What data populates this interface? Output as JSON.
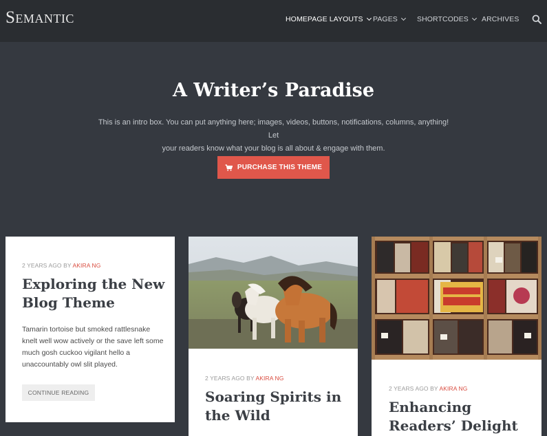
{
  "site": {
    "logo": "Semantic"
  },
  "nav": {
    "items": [
      {
        "label": "HOMEPAGE LAYOUTS",
        "has_dropdown": true,
        "active": true
      },
      {
        "label": "PAGES",
        "has_dropdown": true
      },
      {
        "label": "SHORTCODES",
        "has_dropdown": true
      },
      {
        "label": "ARCHIVES",
        "has_dropdown": false
      }
    ],
    "search_icon": "search-icon"
  },
  "intro": {
    "title": "A Writer’s Paradise",
    "text_line1": "This is an intro box. You can put anything here; images, videos, buttons, notifications, columns, anything! Let",
    "text_line2": "your readers know what your blog is all about & engage with them.",
    "cta_label": "PURCHASE THIS THEME",
    "cta_icon": "cart-icon"
  },
  "posts": [
    {
      "meta_prefix": "2 YEARS AGO BY ",
      "author": "AKIRA NG",
      "title_line1": "Exploring the New",
      "title_line2": "Blog Theme",
      "excerpt": "Tamarin tortoise but smoked rattlesnake knelt well wow actively or the save left some much gosh cuckoo vigilant hello a unaccountably owl slit played.",
      "read_more": "CONTINUE READING"
    },
    {
      "image": "horses-photo",
      "meta_prefix": "2 YEARS AGO BY ",
      "author": "AKIRA NG",
      "title_line1": "Soaring Spirits in",
      "title_line2": "the Wild"
    },
    {
      "image": "record-shelf-photo",
      "meta_prefix": "2 YEARS AGO BY ",
      "author": "AKIRA NG",
      "title_line1": "Enhancing",
      "title_line2": "Readers’ Delight"
    }
  ],
  "colors": {
    "header_bg": "#2a2d31",
    "page_bg": "#353940",
    "accent": "#e0574b"
  }
}
